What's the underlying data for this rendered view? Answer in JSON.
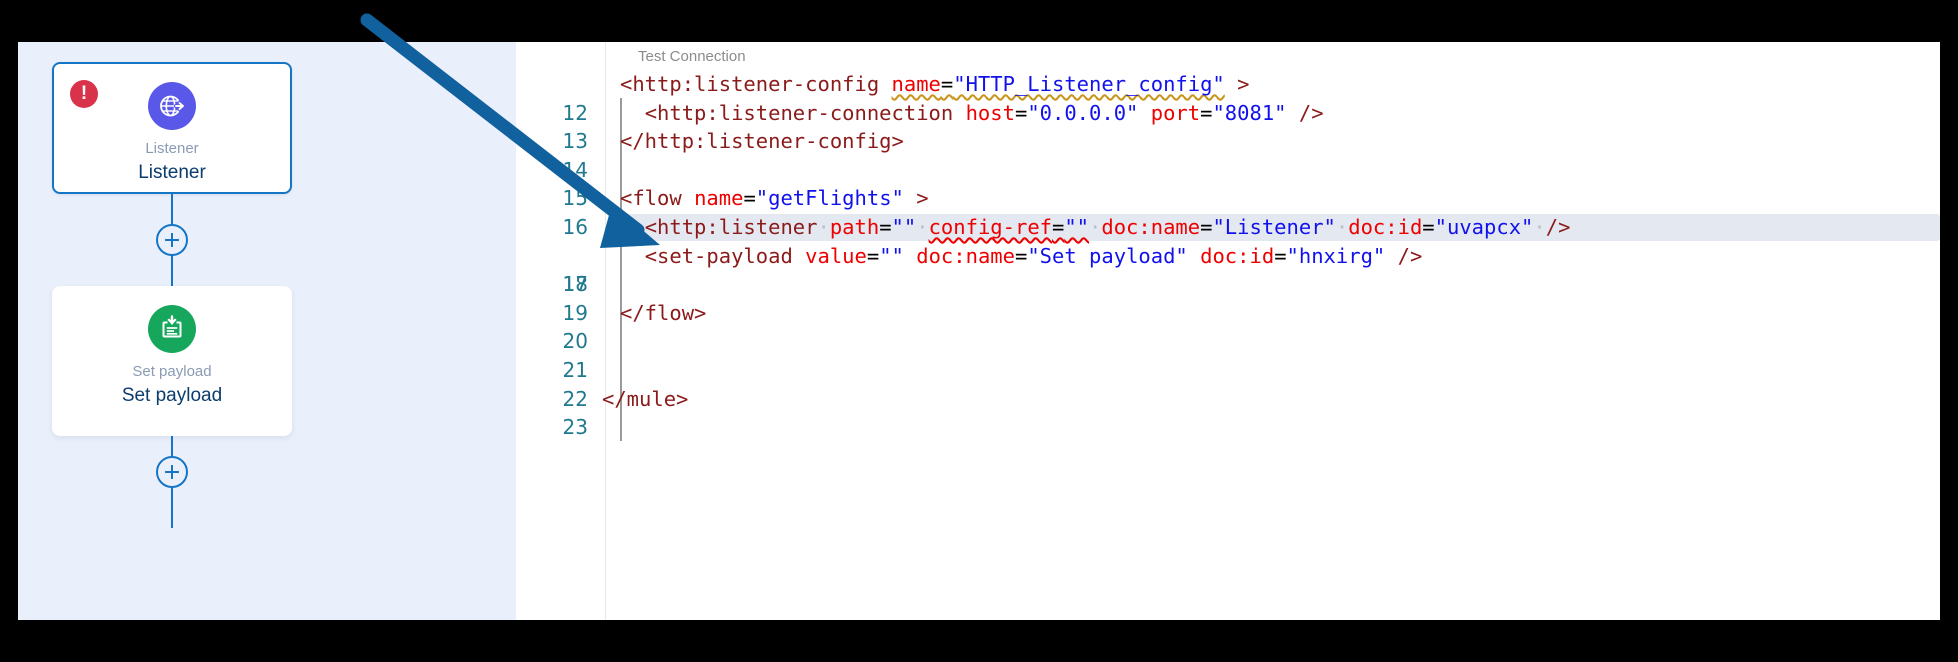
{
  "canvas": {
    "nodes": [
      {
        "type_label": "Listener",
        "name_label": "Listener",
        "icon": "globe-arrow-icon",
        "icon_color": "#5a58e8",
        "selected": true,
        "error_badge": "!"
      },
      {
        "type_label": "Set payload",
        "name_label": "Set payload",
        "icon": "set-payload-icon",
        "icon_color": "#16a75c",
        "selected": false
      }
    ],
    "add_button_label": "+",
    "background_color": "#eaf0fb",
    "connector_color": "#1675c4"
  },
  "editor": {
    "codelens_label": "Test Connection",
    "line_number_color": "#21798f",
    "highlight_color": "#e4e8f0",
    "lines": [
      {
        "number": "12",
        "highlighted": false
      },
      {
        "number": "13",
        "highlighted": false
      },
      {
        "number": "14",
        "highlighted": false
      },
      {
        "number": "15",
        "highlighted": false
      },
      {
        "number": "16",
        "highlighted": false
      },
      {
        "number": "17",
        "highlighted": true
      },
      {
        "number": "18",
        "highlighted": false
      },
      {
        "number": "19",
        "highlighted": false
      },
      {
        "number": "20",
        "highlighted": false
      },
      {
        "number": "21",
        "highlighted": false
      },
      {
        "number": "22",
        "highlighted": false
      },
      {
        "number": "23",
        "highlighted": false
      }
    ],
    "code_text": {
      "l12": "  <http:listener-config name=\"HTTP_Listener_config\" >",
      "l13": "    <http:listener-connection host=\"0.0.0.0\" port=\"8081\" />",
      "l14": "  </http:listener-config>",
      "l15": "",
      "l16": "  <flow name=\"getFlights\" >",
      "l17": "    <http:listener path=\"\" config-ref=\"\" doc:name=\"Listener\" doc:id=\"uvapcx\" />",
      "l18": "    <set-payload value=\"\" doc:name=\"Set payload\" doc:id=\"hnxirg\" />",
      "l19": "",
      "l20": "  </flow>",
      "l21": "",
      "l22": "",
      "l23": "</mule>"
    }
  },
  "annotation": {
    "arrow_color": "#11619e",
    "arrow_from": "365,18",
    "arrow_to": "655,243"
  }
}
